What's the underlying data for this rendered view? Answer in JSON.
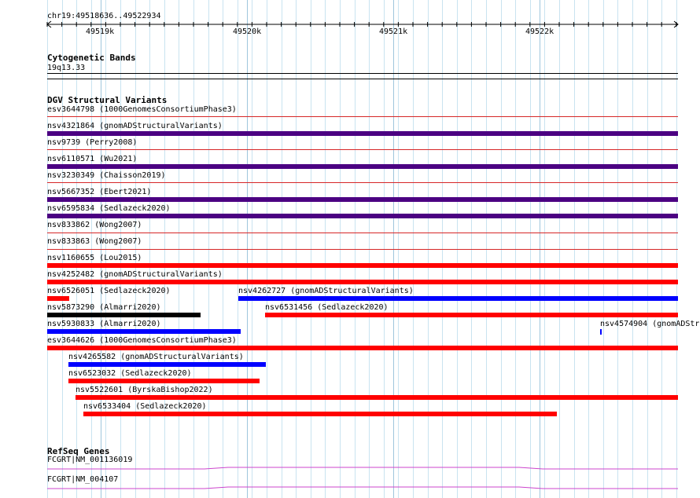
{
  "ruler": {
    "location": "chr19:49518636..49522934",
    "ticks": [
      "49519k",
      "49520k",
      "49521k",
      "49522k"
    ]
  },
  "cytoband_track": {
    "title": "Cytogenetic Bands",
    "band": "19q13.33"
  },
  "dgv_track": {
    "title": "DGV Structural Variants",
    "features": [
      {
        "label": "esv3644798 (1000GenomesConsortiumPhase3)",
        "color": "#d62728",
        "style": "line"
      },
      {
        "label": "nsv4321864 (gnomADStructuralVariants)",
        "color": "#4b0082",
        "style": "thick"
      },
      {
        "label": "nsv9739 (Perry2008)",
        "color": "#d62728",
        "style": "line"
      },
      {
        "label": "nsv6110571 (Wu2021)",
        "color": "#4b0082",
        "style": "thick"
      },
      {
        "label": "nsv3230349 (Chaisson2019)",
        "color": "#d62728",
        "style": "line"
      },
      {
        "label": "nsv5667352 (Ebert2021)",
        "color": "#4b0082",
        "style": "thick"
      },
      {
        "label": "nsv6595834 (Sedlazeck2020)",
        "color": "#4b0082",
        "style": "thick"
      },
      {
        "label": "nsv833862 (Wong2007)",
        "color": "#d62728",
        "style": "line"
      },
      {
        "label": "nsv833863 (Wong2007)",
        "color": "#d62728",
        "style": "line"
      },
      {
        "label": "nsv1160655 (Lou2015)",
        "color": "#ff0000",
        "style": "thick"
      },
      {
        "label": "nsv4252482 (gnomADStructuralVariants)",
        "color": "#ff0000",
        "style": "thick"
      },
      {
        "label": "nsv6526051 (Sedlazeck2020)",
        "color": "#ff0000",
        "style": "thick"
      },
      {
        "label": "nsv4262727 (gnomADStructuralVariants)",
        "color": "#0000ff",
        "style": "thick"
      },
      {
        "label": "nsv5873290 (Almarri2020)",
        "color": "#000000",
        "style": "thick"
      },
      {
        "label": "nsv6531456 (Sedlazeck2020)",
        "color": "#ff0000",
        "style": "thick"
      },
      {
        "label": "nsv5930833 (Almarri2020)",
        "color": "#0000ff",
        "style": "thick"
      },
      {
        "label": "nsv4574904 (gnomADStru",
        "color": "#0000ff",
        "style": "tick"
      },
      {
        "label": "esv3644626 (1000GenomesConsortiumPhase3)",
        "color": "#ff0000",
        "style": "thick"
      },
      {
        "label": "nsv4265582 (gnomADStructuralVariants)",
        "color": "#0000ff",
        "style": "thick"
      },
      {
        "label": "nsv6523032 (Sedlazeck2020)",
        "color": "#ff0000",
        "style": "thick"
      },
      {
        "label": "nsv5522601 (ByrskaBishop2022)",
        "color": "#ff0000",
        "style": "thick"
      },
      {
        "label": "nsv6533404 (Sedlazeck2020)",
        "color": "#ff0000",
        "style": "thick"
      }
    ]
  },
  "refseq_track": {
    "title": "RefSeq Genes",
    "genes": [
      {
        "label": "FCGRT|NM_001136019",
        "color": "#cc44cc"
      },
      {
        "label": "FCGRT|NM_004107",
        "color": "#cc44cc"
      }
    ]
  }
}
